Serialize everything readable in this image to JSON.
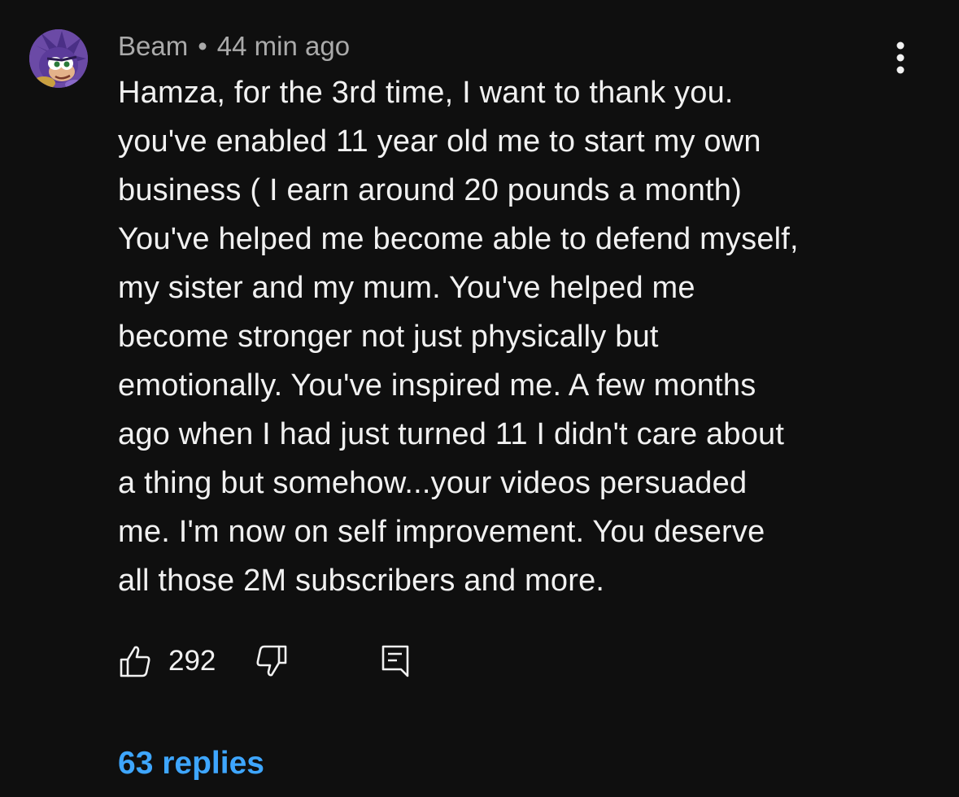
{
  "comment": {
    "author": "Beam",
    "separator": "•",
    "time_ago": "44 min ago",
    "text": "Hamza, for the 3rd time, I want to thank you.\nyou've enabled 11 year old me to start my own\nbusiness ( I earn around 20 pounds a month)\nYou've helped me become able to defend myself,\nmy sister and my mum. You've helped me\nbecome stronger not just physically but\nemotionally. You've inspired me. A few months\nago when I had just turned 11 I didn't care about\na thing but somehow...your videos persuaded\nme. I'm now on self improvement.  You deserve\nall those 2M subscribers and more.",
    "like_count": "292",
    "replies_label": "63 replies"
  },
  "icons": {
    "avatar": "character-avatar",
    "menu": "more-vert-icon",
    "like": "thumbs-up-icon",
    "dislike": "thumbs-down-icon",
    "reply": "comment-reply-icon"
  },
  "colors": {
    "background": "#0f0f0f",
    "text": "#f1f1f1",
    "meta": "#aaaaaa",
    "link": "#3ea6ff"
  }
}
